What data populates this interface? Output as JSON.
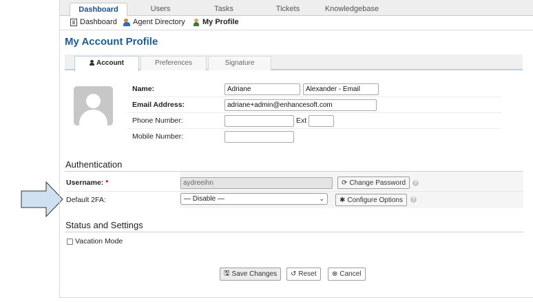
{
  "nav": {
    "tabs": [
      {
        "label": "Dashboard",
        "active": true
      },
      {
        "label": "Users"
      },
      {
        "label": "Tasks"
      },
      {
        "label": "Tickets"
      },
      {
        "label": "Knowledgebase"
      }
    ],
    "sub": [
      {
        "label": "Dashboard",
        "icon": "document-icon"
      },
      {
        "label": "Agent Directory",
        "icon": "people-icon"
      },
      {
        "label": "My Profile",
        "icon": "person-icon",
        "active": true
      }
    ]
  },
  "page_title": "My Account Profile",
  "profile_tabs": [
    {
      "label": "Account",
      "active": true
    },
    {
      "label": "Preferences"
    },
    {
      "label": "Signature"
    }
  ],
  "account": {
    "name_label": "Name:",
    "first_name": "Adriane",
    "last_name": "Alexander - Email",
    "email_label": "Email Address:",
    "email": "adriane+admin@enhancesoft.com",
    "phone_label": "Phone Number:",
    "phone": "",
    "ext_label": "Ext",
    "ext": "",
    "mobile_label": "Mobile Number:",
    "mobile": ""
  },
  "authentication": {
    "title": "Authentication",
    "username_label": "Username:",
    "required_mark": "*",
    "username": "aydreeihn",
    "change_password": "Change Password",
    "default_2fa_label": "Default 2FA:",
    "default_2fa_value": "— Disable —",
    "configure_options": "Configure Options",
    "help_glyph": "?"
  },
  "status": {
    "title": "Status and Settings",
    "vacation_label": "Vacation Mode",
    "vacation_checked": false
  },
  "actions": {
    "save": "Save Changes",
    "reset": "Reset",
    "cancel": "Cancel"
  },
  "colors": {
    "link": "#1b5d96",
    "required": "#cc0000",
    "arrow_fill": "#cfe0f1"
  }
}
